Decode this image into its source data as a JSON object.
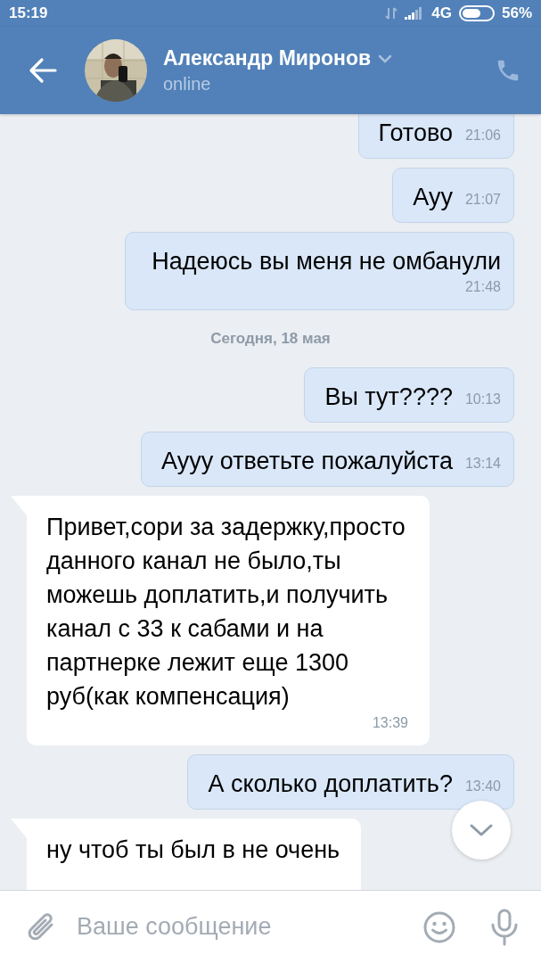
{
  "status_bar": {
    "time": "15:19",
    "network": "4G",
    "battery": "56%"
  },
  "header": {
    "name": "Александр Миронов",
    "status": "online"
  },
  "messages": [
    {
      "kind": "out",
      "text": "Готово",
      "time": "21:06"
    },
    {
      "kind": "out",
      "text": "Ауу",
      "time": "21:07"
    },
    {
      "kind": "out",
      "text": "Надеюсь вы меня не омбанули",
      "time": "21:48"
    },
    {
      "kind": "date",
      "text": "Сегодня, 18 мая"
    },
    {
      "kind": "out",
      "text": "Вы тут????",
      "time": "10:13"
    },
    {
      "kind": "out",
      "text": "Аууу ответьте пожалуйста",
      "time": "13:14"
    },
    {
      "kind": "in",
      "text": "Привет,сори за задержку,просто данного канал не было,ты можешь доплатить,и получить канал с 33 к сабами и на партнерке лежит еще 1300 руб(как компенсация)",
      "time": "13:39"
    },
    {
      "kind": "out",
      "text": "А сколько доплатить?",
      "time": "13:40"
    },
    {
      "kind": "in",
      "text": "ну чтоб ты был в не очень"
    }
  ],
  "composer": {
    "placeholder": "Ваше сообщение"
  }
}
